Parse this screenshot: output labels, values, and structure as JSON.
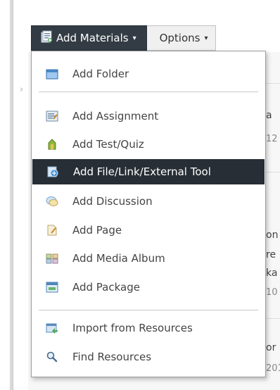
{
  "toolbar": {
    "add_materials_label": "Add Materials",
    "options_label": "Options",
    "caret": "▾"
  },
  "menu": {
    "items": [
      {
        "label": "Add Folder",
        "icon": "folder-icon"
      },
      {
        "label": "Add Assignment",
        "icon": "assignment-icon"
      },
      {
        "label": "Add Test/Quiz",
        "icon": "quiz-icon"
      },
      {
        "label": "Add File/Link/External Tool",
        "icon": "file-link-icon",
        "active": true
      },
      {
        "label": "Add Discussion",
        "icon": "discussion-icon"
      },
      {
        "label": "Add Page",
        "icon": "page-icon"
      },
      {
        "label": "Add Media Album",
        "icon": "media-album-icon"
      },
      {
        "label": "Add Package",
        "icon": "package-icon"
      },
      {
        "label": "Import from Resources",
        "icon": "import-icon"
      },
      {
        "label": "Find Resources",
        "icon": "find-icon"
      }
    ]
  },
  "background": {
    "collapse_arrow": "›",
    "fragments": [
      "a",
      "12",
      "on",
      "re",
      "ka",
      "10",
      "or",
      "201"
    ]
  },
  "colors": {
    "toolbar_dark": "#333c44",
    "active_item": "#272e35",
    "menu_border": "#9c9c9c"
  }
}
